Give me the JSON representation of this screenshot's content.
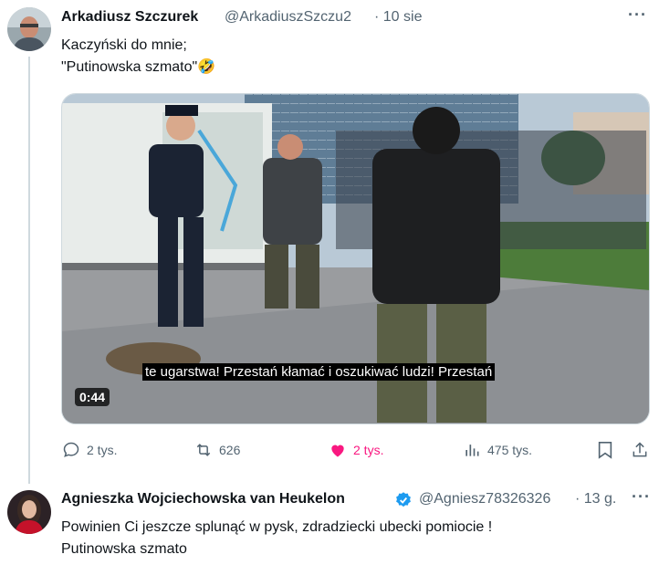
{
  "tweet1": {
    "author": "Arkadiusz Szczurek",
    "handle": "@ArkadiuszSzczu2",
    "date": "· 10 sie",
    "more_icon": "more-dots-icon",
    "text_line1": "Kaczyński do mnie;",
    "text_line2": "\"Putinowska szmato\"🤣",
    "video": {
      "caption": "te ugarstwa! Przestań kłamać i oszukiwać ludzi! Przestań",
      "duration": "0:44"
    },
    "actions": {
      "replies": "2 tys.",
      "reposts": "626",
      "likes": "2 tys.",
      "views": "475 tys."
    },
    "colors": {
      "like": "#f91880",
      "muted": "#536471"
    }
  },
  "tweet2": {
    "author": "Agnieszka Wojciechowska van Heukelon",
    "handle": "@Agniesz78326326",
    "date": "· 13 g.",
    "verified_icon": "verified-badge-icon",
    "text_line1": "Powinien Ci jeszcze splunąć w pysk, zdradziecki ubecki pomiocie !",
    "text_line2": "Putinowska szmato"
  }
}
